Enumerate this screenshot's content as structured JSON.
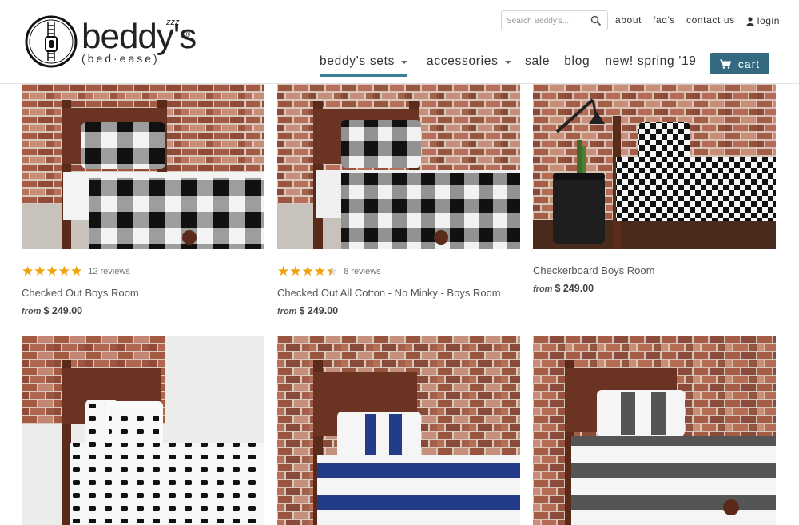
{
  "brand": {
    "name": "beddy's",
    "tagline": "(bed·ease)",
    "zzz": "zzz",
    "registered": "®"
  },
  "search": {
    "placeholder": "Search Beddy's..."
  },
  "top_links": {
    "about": "about",
    "faqs": "faq's",
    "contact": "contact us",
    "login": "login"
  },
  "main_nav": [
    {
      "label": "beddy's sets",
      "has_dropdown": true,
      "active": true
    },
    {
      "label": "accessories",
      "has_dropdown": true,
      "active": false
    },
    {
      "label": "sale",
      "has_dropdown": false,
      "active": false
    },
    {
      "label": "blog",
      "has_dropdown": false,
      "active": false
    },
    {
      "label": "new! spring '19",
      "has_dropdown": false,
      "active": false
    }
  ],
  "cart": {
    "label": "cart"
  },
  "colors": {
    "accent": "#336a80",
    "nav_underline": "#3d7f98",
    "star": "#f1a208"
  },
  "products": [
    {
      "title": "Checked Out Boys Room",
      "from_label": "from",
      "price": "$ 249.00",
      "rating": 5,
      "reviews": "12 reviews",
      "pattern": "buffalo-check"
    },
    {
      "title": "Checked Out All Cotton - No Minky - Boys Room",
      "from_label": "from",
      "price": "$ 249.00",
      "rating": 4.5,
      "reviews": "8 reviews",
      "pattern": "buffalo-check-cotton"
    },
    {
      "title": "Checkerboard Boys Room",
      "from_label": "from",
      "price": "$ 249.00",
      "rating": null,
      "reviews": "",
      "pattern": "checkerboard"
    },
    {
      "title": "",
      "from_label": "",
      "price": "",
      "rating": null,
      "reviews": "",
      "pattern": "black-dash"
    },
    {
      "title": "",
      "from_label": "",
      "price": "",
      "rating": null,
      "reviews": "",
      "pattern": "blue-stripe"
    },
    {
      "title": "",
      "from_label": "",
      "price": "",
      "rating": null,
      "reviews": "",
      "pattern": "gray-stripe"
    }
  ]
}
